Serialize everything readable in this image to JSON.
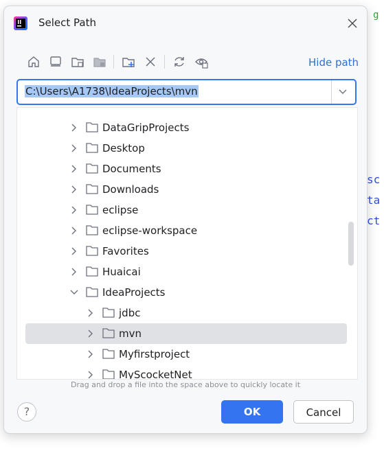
{
  "dialog": {
    "title": "Select Path",
    "hide_path_label": "Hide path",
    "path_value": "C:\\Users\\A1738\\IdeaProjects\\mvn",
    "hint": "Drag and drop a file into the space above to quickly locate it",
    "ok_label": "OK",
    "cancel_label": "Cancel",
    "help_label": "?"
  },
  "toolbar_icons": [
    "home-icon",
    "desktop-icon",
    "project-folder-icon",
    "module-folder-icon",
    "new-folder-icon",
    "delete-icon",
    "refresh-icon",
    "show-hidden-icon"
  ],
  "tree": {
    "items": [
      {
        "label": "DataGripProjects",
        "expanded": false
      },
      {
        "label": "Desktop",
        "expanded": false
      },
      {
        "label": "Documents",
        "expanded": false
      },
      {
        "label": "Downloads",
        "expanded": false
      },
      {
        "label": "eclipse",
        "expanded": false
      },
      {
        "label": "eclipse-workspace",
        "expanded": false
      },
      {
        "label": "Favorites",
        "expanded": false
      },
      {
        "label": "Huaicai",
        "expanded": false
      },
      {
        "label": "IdeaProjects",
        "expanded": true
      },
      {
        "label": "jdbc",
        "expanded": false
      },
      {
        "label": "mvn",
        "expanded": false,
        "selected": true
      },
      {
        "label": "Myfirstproject",
        "expanded": false
      },
      {
        "label": "MyScocketNet",
        "expanded": false
      }
    ]
  },
  "colors": {
    "accent": "#3574f0",
    "selection": "#dfe1e5",
    "text_selection": "#a6c8f5",
    "link": "#2f6fd6"
  },
  "background": {
    "fragments": [
      "sc",
      "ta",
      "ct",
      "g"
    ]
  }
}
